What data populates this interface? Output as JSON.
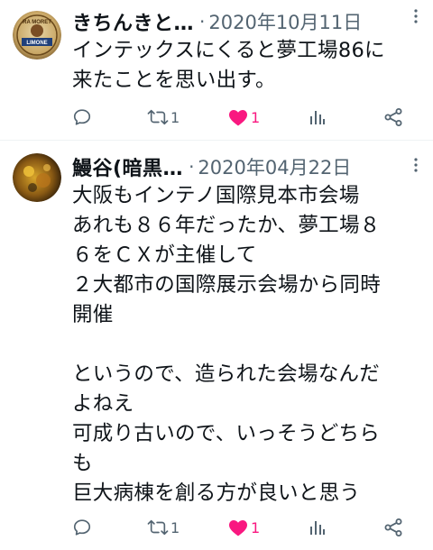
{
  "tweets": [
    {
      "author": "きちんきと…",
      "separator": "·",
      "date": "2020年10月11日",
      "text": "インテックスにくると夢工場86に\n来たことを思い出す。",
      "avatar_text": "RA MORET\nLIMONE",
      "retweets": "1",
      "likes": "1",
      "liked": true
    },
    {
      "author": "鰻谷(暗黒…",
      "separator": "·",
      "date": "2020年04月22日",
      "text": "大阪もインテノ国際見本市会場\nあれも８６年だったか、夢工場８\n６をＣＸが主催して\n２大都市の国際展示会場から同時\n開催\n\nというので、造られた会場なんだ\nよねえ\n可成り古いので、いっそうどちら\nも\n巨大病棟を創る方が良いと思う",
      "retweets": "1",
      "likes": "1",
      "liked": true
    }
  ],
  "icons": {
    "reply": "speech-bubble-icon",
    "retweet": "retweet-arrows-icon",
    "like": "heart-icon",
    "stats": "bar-chart-icon",
    "share": "share-nodes-icon",
    "more": "vertical-dots-icon"
  },
  "colors": {
    "text": "#0f1419",
    "secondary": "#536471",
    "like": "#f91880",
    "divider": "#eff3f4"
  }
}
